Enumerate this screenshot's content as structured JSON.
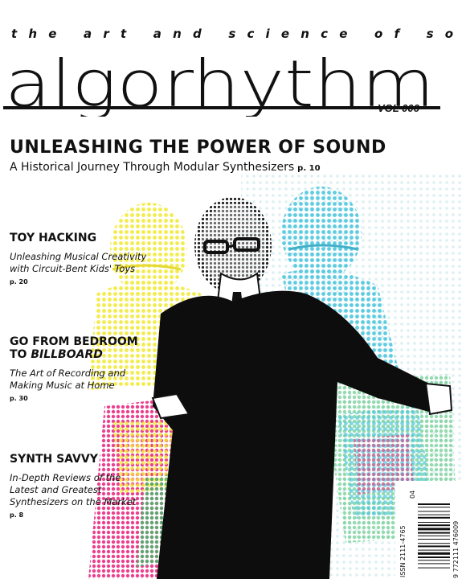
{
  "masthead": {
    "tagline": "the art and science of sound",
    "logo": "algorhythm",
    "volume": "VOL 006"
  },
  "cover_story": {
    "title": "UNLEASHING THE POWER OF SOUND",
    "subtitle": "A Historical Journey Through Modular Synthesizers",
    "page": "p. 10"
  },
  "stories": [
    {
      "title": "TOY HACKING",
      "description": "Unleashing Musical Creativity with Circuit-Bent Kids' Toys",
      "page": "p. 20"
    },
    {
      "title_line1": "GO FROM BEDROOM",
      "title_line2_prefix": "TO ",
      "title_line2_emphasis": "BILLBOARD",
      "description": "The Art of Recording and Making Music at Home",
      "page": "p. 30"
    },
    {
      "title": "SYNTH SAVVY",
      "description": "In-Depth Reviews of the Latest and Greatest Synthesizers on the Market",
      "page": "p. 8"
    }
  ],
  "barcode": {
    "issn": "ISSN 2111-4765",
    "number": "9 772111 476009",
    "issue": "04"
  },
  "colors": {
    "ink": "#111111",
    "yellow": "#f2ea3a",
    "cyan": "#4cc6df",
    "magenta": "#ec3f8f",
    "green": "#3dbd6b"
  }
}
